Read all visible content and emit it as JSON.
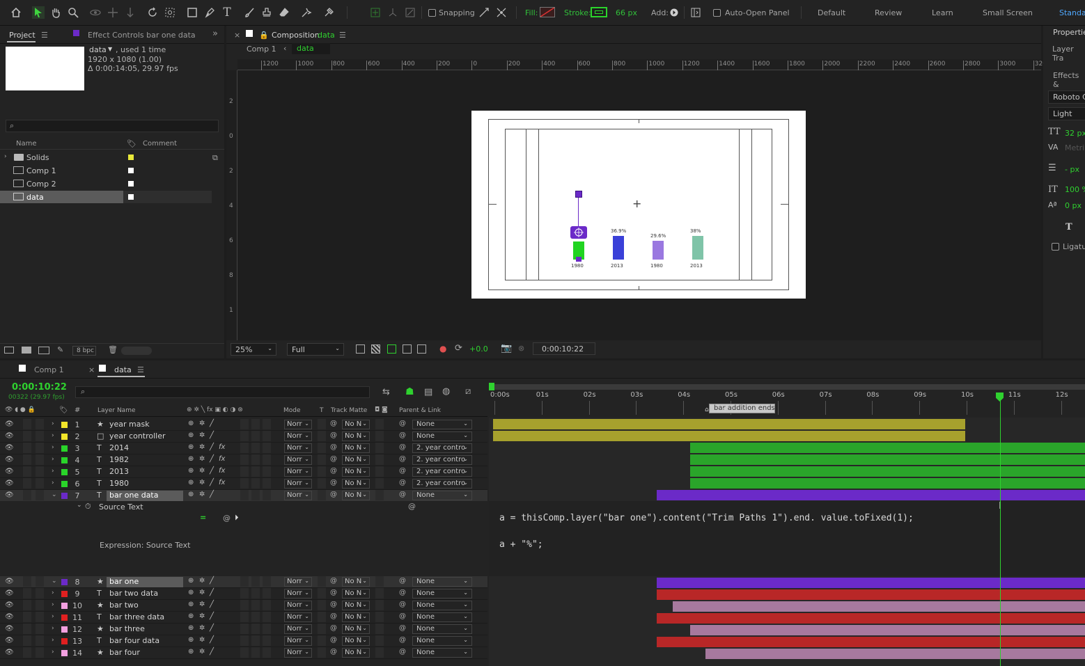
{
  "toolbar": {
    "snapping": "Snapping",
    "fill": "Fill:",
    "stroke": "Stroke:",
    "stroke_px": "66 px",
    "add": "Add:",
    "auto_open": "Auto-Open Panel",
    "workspaces": [
      "Default",
      "Review",
      "Learn",
      "Small Screen",
      "Standa"
    ],
    "colors": {
      "stroke_green": "#2bd42b",
      "fill_red": "#a82222"
    }
  },
  "project": {
    "tab_project": "Project",
    "tab_effects": "Effect Controls bar one data",
    "item_name": "data",
    "item_used": ", used 1 time",
    "item_size": "1920 x 1080 (1.00)",
    "item_duration": "Δ 0:00:14:05, 29.97 fps",
    "col_name": "Name",
    "col_comment": "Comment",
    "items": [
      {
        "name": "Solids",
        "color": "#e8e83a"
      },
      {
        "name": "Comp 1",
        "color": "#ffffff"
      },
      {
        "name": "Comp 2",
        "color": "#ffffff"
      },
      {
        "name": "data",
        "color": "#ffffff"
      }
    ],
    "bpc": "8 bpc"
  },
  "comp": {
    "tab_prefix": "Composition",
    "tab_name": "data",
    "breadcrumb_comp1": "Comp 1",
    "breadcrumb_data": "data",
    "ruler_top": [
      "1200",
      "1000",
      "800",
      "600",
      "400",
      "200",
      "0",
      "200",
      "400",
      "600",
      "800",
      "1000",
      "1200",
      "1400",
      "1600",
      "1800",
      "2000",
      "2200",
      "2400",
      "2600",
      "2800",
      "3000",
      "320"
    ],
    "ruler_left": [
      "2",
      "0",
      "2",
      "4",
      "6",
      "8",
      "1",
      "1"
    ],
    "zoom": "25%",
    "resolution": "Full",
    "exposure": "+0.0",
    "timecode": "0:00:10:22",
    "bars": [
      {
        "label": "1980",
        "value_label": "",
        "color": "#21d421"
      },
      {
        "label": "2013",
        "value_label": "36.9%",
        "color": "#3a40d8"
      },
      {
        "label": "1980",
        "value_label": "29.6%",
        "color": "#9a78e0"
      },
      {
        "label": "2013",
        "value_label": "38%",
        "color": "#7fc4a8"
      }
    ]
  },
  "props": {
    "title": "Propertie",
    "layer_tr": "Layer Tra",
    "effects": "Effects &",
    "font": "Roboto C",
    "style": "Light",
    "size": "32 px",
    "metrics": "Metri",
    "lead": "- px",
    "scale": "100 %",
    "baseline": "0 px",
    "ligatures": "Ligatu"
  },
  "timeline": {
    "tab_comp1": "Comp 1",
    "tab_data": "data",
    "timecode": "0:00:10:22",
    "frames": "00322 (29.97 fps)",
    "col_layer_name": "Layer Name",
    "col_mode": "Mode",
    "col_t": "T",
    "col_track_matte": "Track Matte",
    "col_parent": "Parent & Link",
    "time_labels": [
      "0:00s",
      "01s",
      "02s",
      "03s",
      "04s",
      "05s",
      "06s",
      "07s",
      "08s",
      "09s",
      "10s",
      "11s",
      "12s"
    ],
    "marker_label": "bar addition ends",
    "layers_top": [
      {
        "num": "1",
        "type": "★",
        "name": "year mask",
        "label": "#f2e52a",
        "mode": "Norr",
        "tm": "No N",
        "parent": "None",
        "fx": false
      },
      {
        "num": "2",
        "type": "□",
        "name": "year controller",
        "label": "#f2e52a",
        "mode": "Norr",
        "tm": "No N",
        "parent": "None",
        "fx": false
      },
      {
        "num": "3",
        "type": "T",
        "name": "2014",
        "label": "#2ad42a",
        "mode": "Norr",
        "tm": "No N",
        "parent": "2. year contro",
        "fx": true
      },
      {
        "num": "4",
        "type": "T",
        "name": "1982",
        "label": "#2ad42a",
        "mode": "Norr",
        "tm": "No N",
        "parent": "2. year contro",
        "fx": true
      },
      {
        "num": "5",
        "type": "T",
        "name": "2013",
        "label": "#2ad42a",
        "mode": "Norr",
        "tm": "No N",
        "parent": "2. year contro",
        "fx": true
      },
      {
        "num": "6",
        "type": "T",
        "name": "1980",
        "label": "#2ad42a",
        "mode": "Norr",
        "tm": "No N",
        "parent": "2. year contro",
        "fx": true
      },
      {
        "num": "7",
        "type": "T",
        "name": "bar one data",
        "label": "#6b2ac8",
        "mode": "Norr",
        "tm": "No N",
        "parent": "None",
        "fx": false
      }
    ],
    "source_text": "Source Text",
    "expression_label": "Expression: Source Text",
    "expression_line1": "a = thisComp.layer(\"bar one\").content(\"Trim Paths 1\").end. value.toFixed(1);",
    "expression_line2": "a + \"%\";",
    "layers_bottom": [
      {
        "num": "8",
        "type": "★",
        "name": "bar one",
        "label": "#6b2ac8",
        "mode": "Norr",
        "tm": "No N",
        "parent": "None"
      },
      {
        "num": "9",
        "type": "T",
        "name": "bar two data",
        "label": "#e02020",
        "mode": "Norr",
        "tm": "No N",
        "parent": "None"
      },
      {
        "num": "10",
        "type": "★",
        "name": "bar two",
        "label": "#f3a0e0",
        "mode": "Norr",
        "tm": "No N",
        "parent": "None"
      },
      {
        "num": "11",
        "type": "T",
        "name": "bar three data",
        "label": "#e02020",
        "mode": "Norr",
        "tm": "No N",
        "parent": "None"
      },
      {
        "num": "12",
        "type": "★",
        "name": "bar three",
        "label": "#f3a0e0",
        "mode": "Norr",
        "tm": "No N",
        "parent": "None"
      },
      {
        "num": "13",
        "type": "T",
        "name": "bar four data",
        "label": "#e02020",
        "mode": "Norr",
        "tm": "No N",
        "parent": "None"
      },
      {
        "num": "14",
        "type": "★",
        "name": "bar four",
        "label": "#f3a0e0",
        "mode": "Norr",
        "tm": "No N",
        "parent": "None"
      }
    ]
  }
}
